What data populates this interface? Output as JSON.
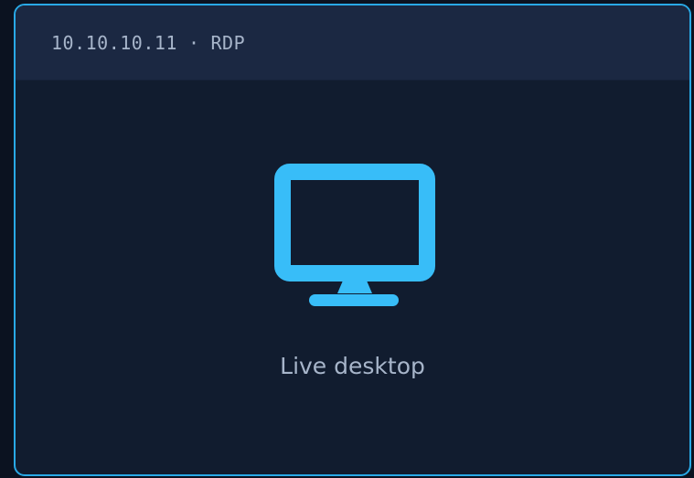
{
  "session": {
    "host": "10.10.10.11",
    "separator": "·",
    "protocol": "RDP"
  },
  "viewport": {
    "icon": "monitor-icon",
    "status_text": "Live desktop"
  },
  "colors": {
    "accent": "#38bdf8",
    "border": "#29a9e6",
    "header_bg": "#1b2842",
    "panel_bg": "#111c2f",
    "page_bg": "#0b1220",
    "muted_text": "#a7b5ca"
  }
}
